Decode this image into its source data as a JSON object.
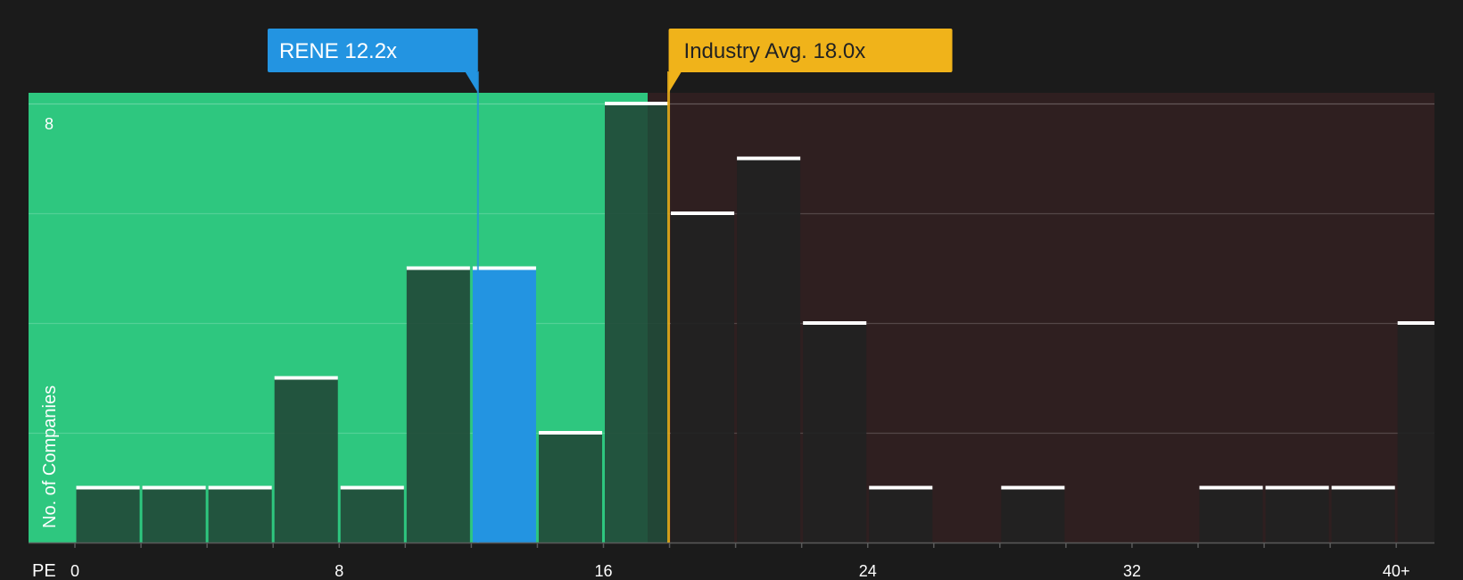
{
  "chart_data": {
    "type": "bar",
    "xlabel": "PE",
    "ylabel": "No. of Companies",
    "x_ticks": [
      "0",
      "8",
      "16",
      "24",
      "32",
      "40+"
    ],
    "y_ticks": [
      "8"
    ],
    "ylim": [
      0,
      8
    ],
    "xlim": [
      0,
      41
    ],
    "bin_width": 2,
    "bins": [
      {
        "start": 0,
        "value": 1
      },
      {
        "start": 2,
        "value": 1
      },
      {
        "start": 4,
        "value": 1
      },
      {
        "start": 6,
        "value": 3
      },
      {
        "start": 8,
        "value": 1
      },
      {
        "start": 10,
        "value": 5
      },
      {
        "start": 12,
        "value": 5,
        "highlight": true
      },
      {
        "start": 14,
        "value": 2
      },
      {
        "start": 16,
        "value": 8
      },
      {
        "start": 18,
        "value": 6
      },
      {
        "start": 20,
        "value": 7
      },
      {
        "start": 22,
        "value": 4
      },
      {
        "start": 24,
        "value": 1
      },
      {
        "start": 26,
        "value": 0
      },
      {
        "start": 28,
        "value": 1
      },
      {
        "start": 30,
        "value": 0
      },
      {
        "start": 32,
        "value": 0
      },
      {
        "start": 34,
        "value": 1
      },
      {
        "start": 36,
        "value": 1
      },
      {
        "start": 38,
        "value": 1
      },
      {
        "start": 40,
        "value": 4
      }
    ],
    "company": {
      "label": "RENE 12.2x",
      "value": 12.2
    },
    "industry_avg": {
      "label": "Industry Avg. 18.0x",
      "value": 18.0
    },
    "colors": {
      "background": "#1b1b1b",
      "undervalued_zone": "#2ec77f",
      "overvalued_zone": "#2f1f20",
      "bar": "#224a38",
      "bar_over": "#222222",
      "company_bar": "#2394e1",
      "company_callout": "#2394e1",
      "industry_callout": "#f0b31a",
      "bar_top": "#ffffff",
      "grid": "#4a4a4a"
    }
  }
}
